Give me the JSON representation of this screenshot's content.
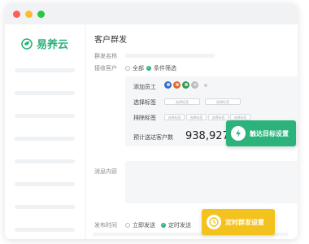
{
  "app": {
    "brand": "易养云",
    "accent": "#2bb37b",
    "callout_yellow": "#f3c21c"
  },
  "page": {
    "title": "客户群发"
  },
  "form": {
    "group_name_label": "群发名称",
    "recipients_label": "接收客户",
    "recipients_options": [
      "全部",
      "条件筛选"
    ],
    "recipients_selected": "条件筛选",
    "panel": {
      "add_staff_label": "添加员工",
      "select_tags_label": "选择标签",
      "select_tags_placeholders": [
        "选择标签",
        "选择标签"
      ],
      "exclude_tags_label": "排除标签",
      "exclude_tags_placeholders": [
        "选择标签",
        "选择标签",
        "选择标签",
        "选择标签"
      ],
      "estimated_label": "预计送达客户数",
      "estimated_count": "938,927"
    },
    "message_label": "消息内容",
    "send_time_label": "发布时间",
    "send_time_options": [
      "立即发送",
      "定时发送"
    ],
    "send_time_selected": "定时发送"
  },
  "callouts": {
    "reach_target": "触达目标设置",
    "scheduled_send": "定时群发设置"
  }
}
